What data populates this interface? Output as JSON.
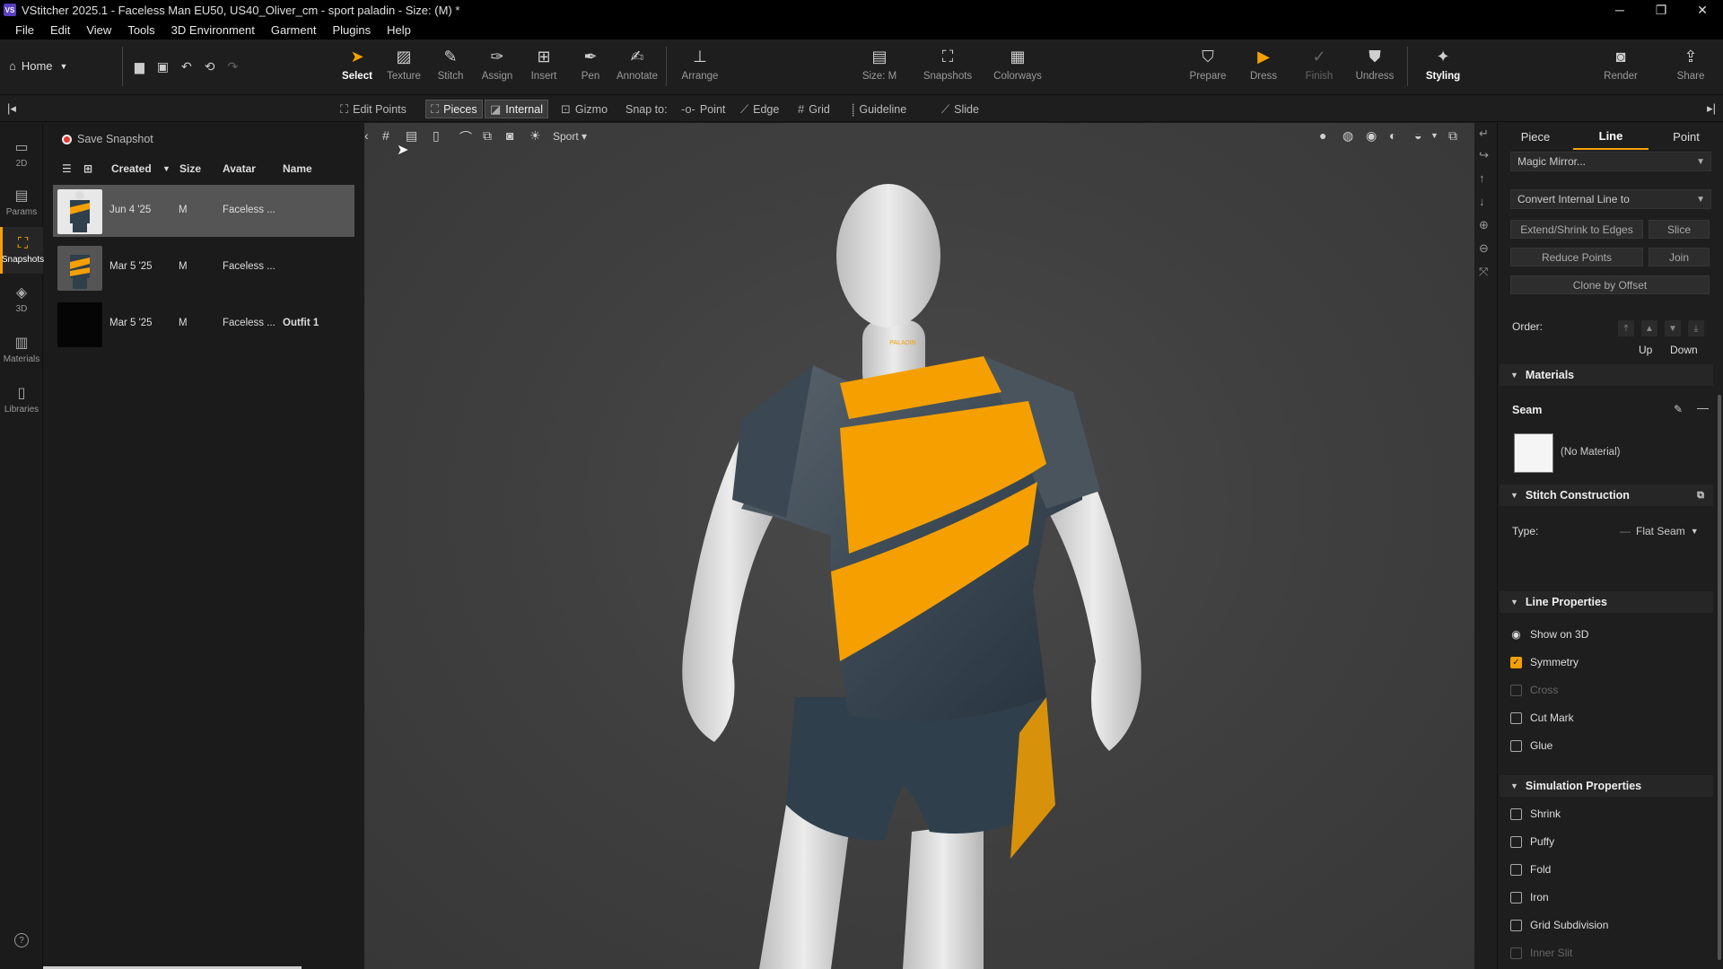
{
  "window": {
    "logo": "VS",
    "title": "VStitcher 2025.1 - Faceless Man EU50, US40_Oliver_cm - sport paladin - Size: (M) *",
    "controls": [
      "─",
      "❐",
      "✕"
    ]
  },
  "menu": [
    "File",
    "Edit",
    "View",
    "Tools",
    "3D Environment",
    "Garment",
    "Plugins",
    "Help"
  ],
  "toolbar": {
    "home": "Home",
    "tools": [
      {
        "label": "Select",
        "icon": "cursor-icon",
        "glyph": "➤"
      },
      {
        "label": "Texture",
        "icon": "texture-icon",
        "glyph": "▨"
      },
      {
        "label": "Stitch",
        "icon": "stitch-icon",
        "glyph": "✎"
      },
      {
        "label": "Assign",
        "icon": "assign-icon",
        "glyph": "✑"
      },
      {
        "label": "Insert",
        "icon": "insert-icon",
        "glyph": "⊞"
      },
      {
        "label": "Pen",
        "icon": "pen-icon",
        "glyph": "✒"
      },
      {
        "label": "Annotate",
        "icon": "annotate-icon",
        "glyph": "✍"
      },
      {
        "label": "Arrange",
        "icon": "arrange-icon",
        "glyph": "⊥"
      }
    ],
    "center_tools": [
      {
        "label": "Size: M",
        "icon": "size-icon",
        "glyph": "▤"
      },
      {
        "label": "Snapshots",
        "icon": "snapshots-icon",
        "glyph": "⛶"
      },
      {
        "label": "Colorways",
        "icon": "colorways-icon",
        "glyph": "▦"
      }
    ],
    "right_tools": [
      {
        "label": "Prepare",
        "icon": "prepare-icon",
        "glyph": "⛉"
      },
      {
        "label": "Dress",
        "icon": "dress-icon",
        "glyph": "▶"
      },
      {
        "label": "Finish",
        "icon": "finish-icon",
        "glyph": "✓"
      },
      {
        "label": "Undress",
        "icon": "undress-icon",
        "glyph": "⛊"
      },
      {
        "label": "Styling",
        "icon": "styling-icon",
        "glyph": "✦"
      }
    ],
    "far_right": [
      {
        "label": "Render",
        "icon": "camera-icon",
        "glyph": "◙"
      },
      {
        "label": "Share",
        "icon": "share-icon",
        "glyph": "⇪"
      }
    ]
  },
  "subbar": {
    "edit_points": "Edit Points",
    "pieces": "Pieces",
    "internal": "Internal",
    "gizmo": "Gizmo",
    "snap_to": "Snap to:",
    "point": "Point",
    "edge": "Edge",
    "grid": "Grid",
    "guideline": "Guideline",
    "slide": "Slide"
  },
  "rail": [
    {
      "label": "2D",
      "glyph": "▭"
    },
    {
      "label": "Params",
      "glyph": "▤"
    },
    {
      "label": "Snapshots",
      "glyph": "⛶"
    },
    {
      "label": "3D",
      "glyph": "◈"
    },
    {
      "label": "Materials",
      "glyph": "▥"
    },
    {
      "label": "Libraries",
      "glyph": "▯"
    }
  ],
  "help_glyph": "?",
  "snapshots": {
    "save_label": "Save Snapshot",
    "columns": [
      "Created",
      "Size",
      "Avatar",
      "Name"
    ],
    "rows": [
      {
        "created": "Jun 4 '25",
        "size": "M",
        "avatar": "Faceless ...",
        "name": ""
      },
      {
        "created": "Mar 5 '25",
        "size": "M",
        "avatar": "Faceless ...",
        "name": ""
      },
      {
        "created": "Mar 5 '25",
        "size": "M",
        "avatar": "Faceless ...",
        "name": "Outfit 1"
      }
    ]
  },
  "viewport": {
    "environment": "Sport",
    "logo_text": "PALADIN"
  },
  "right_panel": {
    "tabs": [
      "Piece",
      "Line",
      "Point"
    ],
    "active_tab": "Line",
    "magic_mirror": "Magic Mirror...",
    "convert": "Convert Internal Line to",
    "buttons": {
      "extend": "Extend/Shrink to Edges",
      "slice": "Slice",
      "reduce": "Reduce Points",
      "join": "Join",
      "clone": "Clone by Offset"
    },
    "order_label": "Order:",
    "order_up": "Up",
    "order_down": "Down",
    "materials_header": "Materials",
    "seam_label": "Seam",
    "no_material": "(No Material)",
    "stitch_header": "Stitch Construction",
    "type_label": "Type:",
    "type_value": "Flat Seam",
    "line_props_header": "Line Properties",
    "line_props": [
      {
        "label": "Show on 3D",
        "state": "eye"
      },
      {
        "label": "Symmetry",
        "state": "on"
      },
      {
        "label": "Cross",
        "state": "dim"
      },
      {
        "label": "Cut Mark",
        "state": "off"
      },
      {
        "label": "Glue",
        "state": "off"
      }
    ],
    "sim_header": "Simulation Properties",
    "sim_props": [
      {
        "label": "Shrink",
        "state": "off"
      },
      {
        "label": "Puffy",
        "state": "off"
      },
      {
        "label": "Fold",
        "state": "off"
      },
      {
        "label": "Iron",
        "state": "off"
      },
      {
        "label": "Grid Subdivision",
        "state": "off"
      },
      {
        "label": "Inner Slit",
        "state": "dim"
      }
    ]
  },
  "colors": {
    "accent": "#f5a000",
    "garment": "#2f3f4b",
    "viewport_bg": "#424242"
  }
}
